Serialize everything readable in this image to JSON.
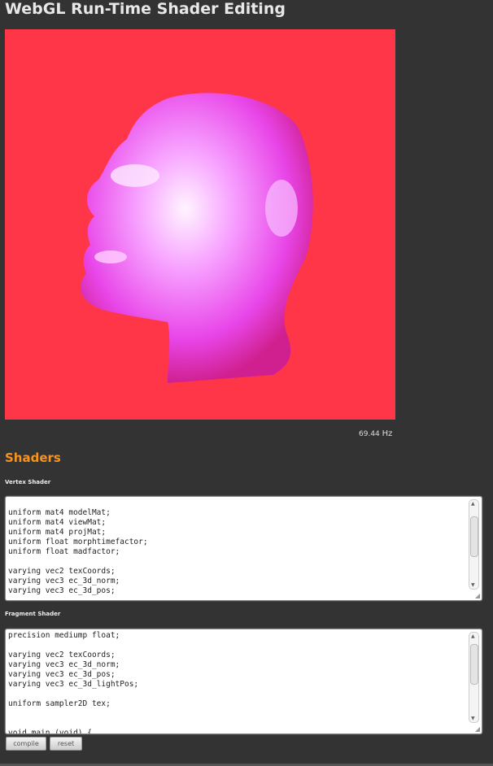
{
  "title": "WebGL Run-Time Shader Editing",
  "fps": {
    "value": "69.44",
    "unit": "Hz"
  },
  "shaders_heading": "Shaders",
  "vertex": {
    "label": "Vertex Shader",
    "code": "\nuniform mat4 modelMat;\nuniform mat4 viewMat;\nuniform mat4 projMat;\nuniform float morphtimefactor;\nuniform float madfactor;\n\nvarying vec2 texCoords;\nvarying vec3 ec_3d_norm;\nvarying vec3 ec_3d_pos;"
  },
  "fragment": {
    "label": "Fragment Shader",
    "code": "precision mediump float;\n\nvarying vec2 texCoords;\nvarying vec3 ec_3d_norm;\nvarying vec3 ec_3d_pos;\nvarying vec3 ec_3d_lightPos;\n\nuniform sampler2D tex;\n\n\nvoid main (void) {"
  },
  "buttons": {
    "compile": "compile",
    "reset": "reset"
  },
  "colors": {
    "canvas_bg": "#ff3548",
    "heading": "#f7931e"
  }
}
